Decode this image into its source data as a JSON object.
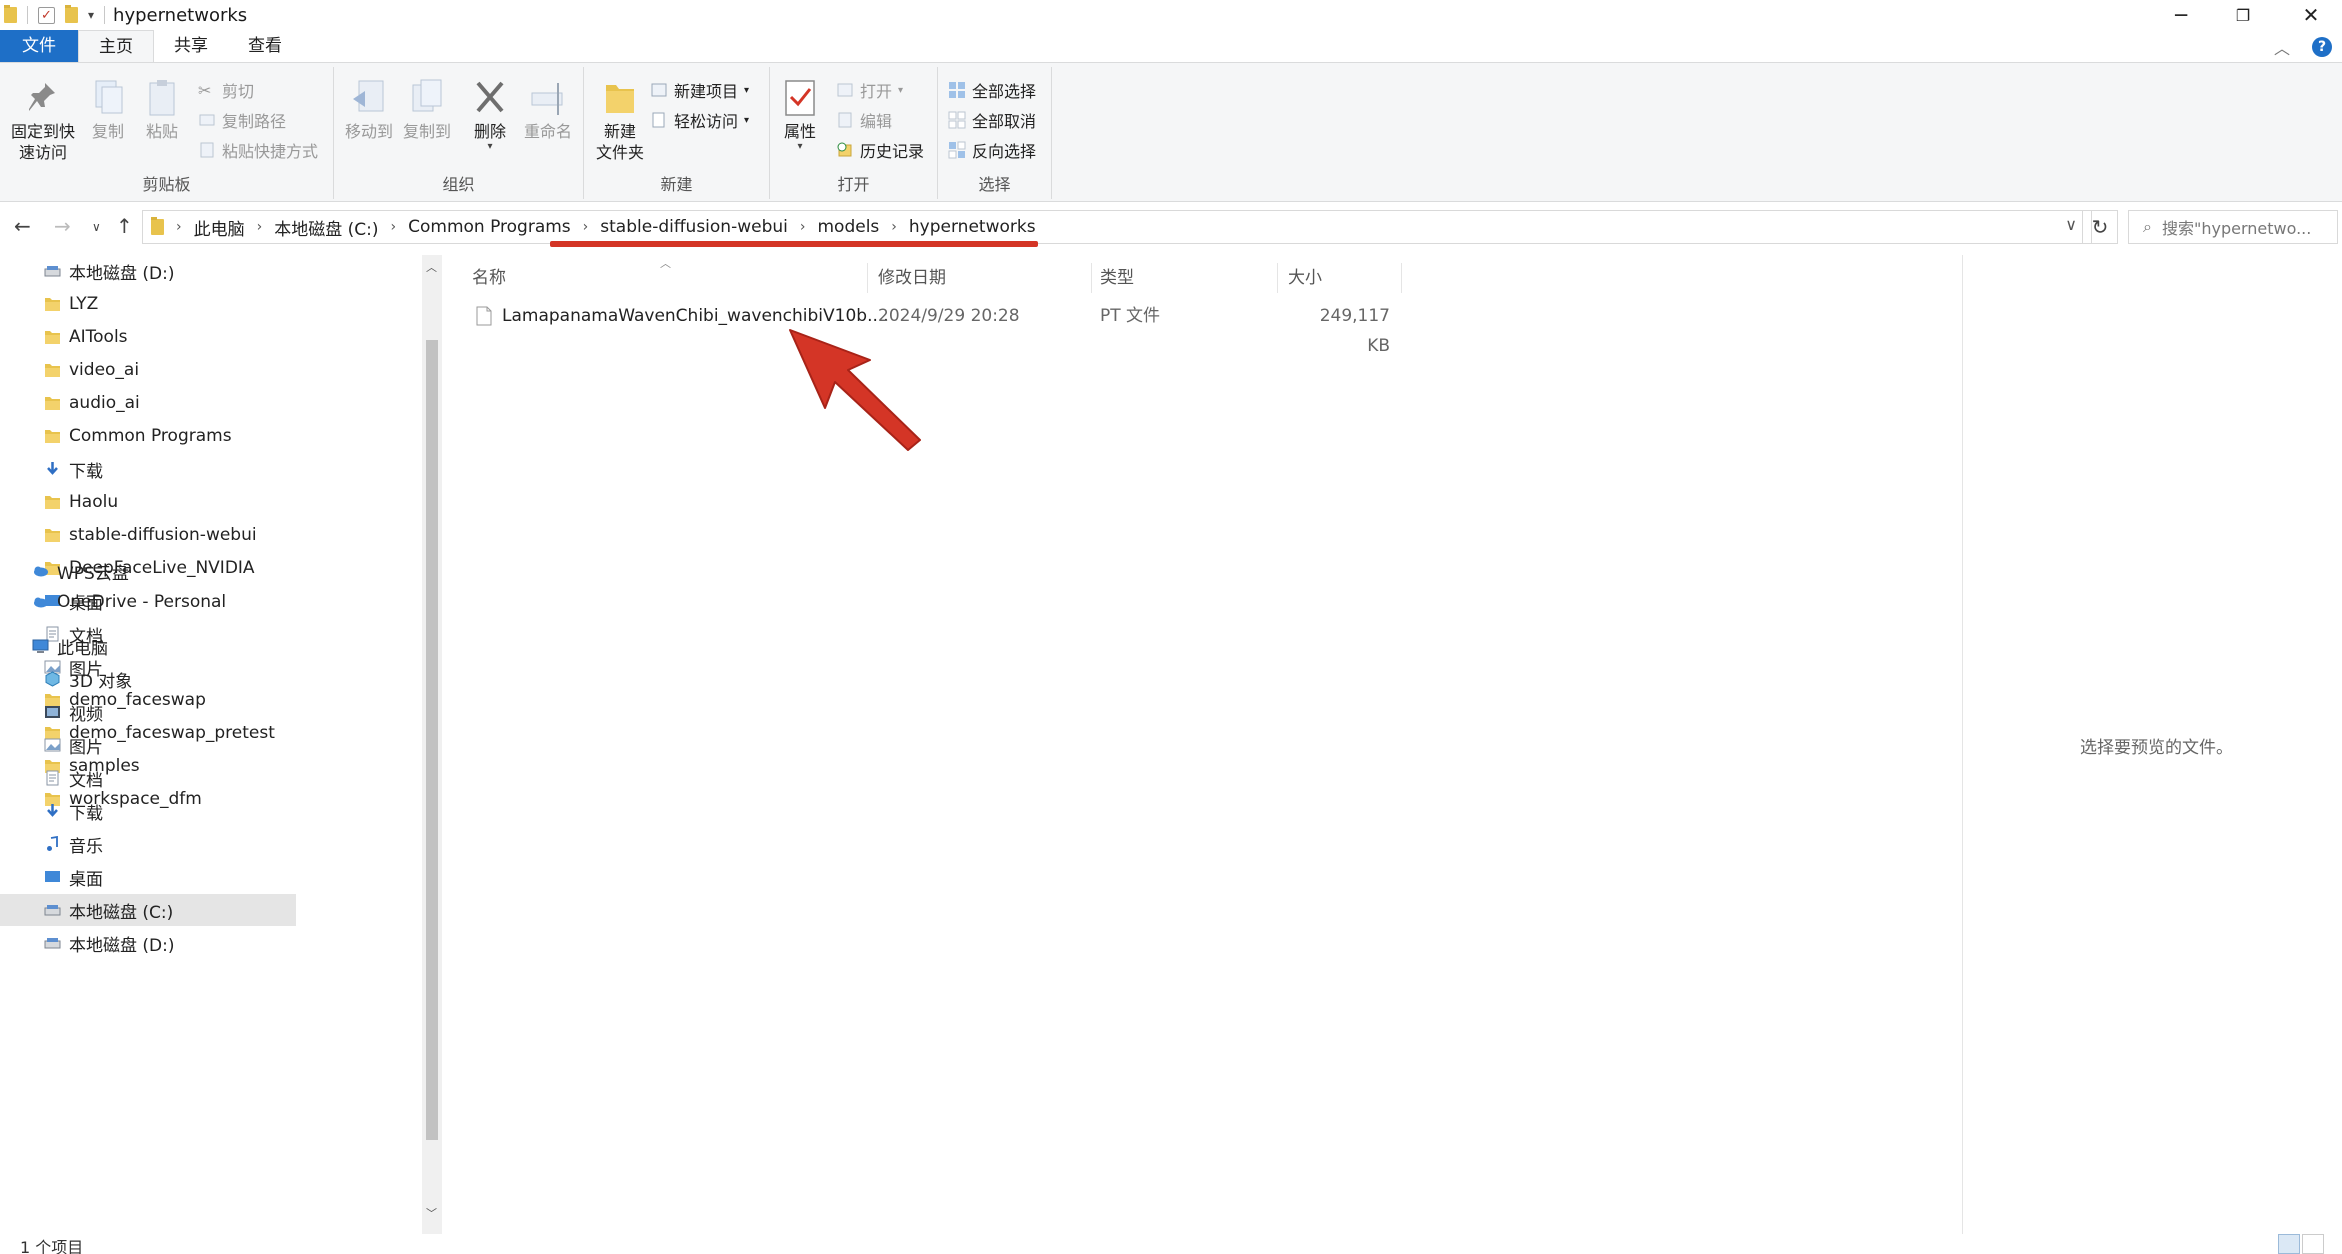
{
  "window": {
    "title": "hypernetworks"
  },
  "tabs": [
    {
      "label": "文件"
    },
    {
      "label": "主页"
    },
    {
      "label": "共享"
    },
    {
      "label": "查看"
    }
  ],
  "ribbon": {
    "clipboard": {
      "label": "剪贴板",
      "pin": "固定到快\n速访问",
      "pin_line1": "固定到快",
      "pin_line2": "速访问",
      "copy": "复制",
      "paste": "粘贴",
      "cut": "剪切",
      "copy_path": "复制路径",
      "paste_shortcut": "粘贴快捷方式"
    },
    "organize": {
      "label": "组织",
      "move_to": "移动到",
      "copy_to": "复制到",
      "delete": "删除",
      "rename": "重命名"
    },
    "new": {
      "label": "新建",
      "new_folder_line1": "新建",
      "new_folder_line2": "文件夹",
      "new_item": "新建项目",
      "easy_access": "轻松访问"
    },
    "open": {
      "label": "打开",
      "properties": "属性",
      "open": "打开",
      "edit": "编辑",
      "history": "历史记录"
    },
    "select": {
      "label": "选择",
      "select_all": "全部选择",
      "select_none": "全部取消",
      "invert": "反向选择"
    }
  },
  "address": {
    "crumbs": [
      "此电脑",
      "本地磁盘 (C:)",
      "Common Programs",
      "stable-diffusion-webui",
      "models",
      "hypernetworks"
    ]
  },
  "search": {
    "placeholder": "搜索\"hypernetwo..."
  },
  "sidebar": {
    "items": [
      {
        "label": "本地磁盘 (D:)",
        "icon": "drive-icon",
        "pinned": true
      },
      {
        "label": "LYZ",
        "icon": "folder-icon",
        "pinned": true
      },
      {
        "label": "AITools",
        "icon": "folder-icon",
        "pinned": true
      },
      {
        "label": "video_ai",
        "icon": "folder-icon",
        "pinned": true
      },
      {
        "label": "audio_ai",
        "icon": "folder-icon",
        "pinned": true
      },
      {
        "label": "Common Programs",
        "icon": "folder-icon",
        "pinned": true
      },
      {
        "label": "下载",
        "icon": "download-icon",
        "pinned": true
      },
      {
        "label": "Haolu",
        "icon": "folder-icon",
        "pinned": true
      },
      {
        "label": "stable-diffusion-webui",
        "icon": "folder-icon",
        "pinned": true
      },
      {
        "label": "DeepFaceLive_NVIDIA",
        "icon": "folder-icon",
        "pinned": true
      },
      {
        "label": "桌面",
        "icon": "desktop-icon",
        "pinned": true
      },
      {
        "label": "文档",
        "icon": "document-icon",
        "pinned": true
      },
      {
        "label": "图片",
        "icon": "pictures-icon",
        "pinned": true
      },
      {
        "label": "demo_faceswap",
        "icon": "folder-icon",
        "pinned": false
      },
      {
        "label": "demo_faceswap_pretest",
        "icon": "folder-icon",
        "pinned": false
      },
      {
        "label": "samples",
        "icon": "folder-icon",
        "pinned": false
      },
      {
        "label": "workspace_dfm",
        "icon": "folder-icon",
        "pinned": false
      }
    ],
    "wps": "WPS云盘",
    "onedrive": "OneDrive - Personal",
    "this_pc": "此电脑",
    "pc_items": [
      {
        "label": "3D 对象",
        "icon": "3d-objects-icon"
      },
      {
        "label": "视频",
        "icon": "videos-icon"
      },
      {
        "label": "图片",
        "icon": "pictures-icon"
      },
      {
        "label": "文档",
        "icon": "document-icon"
      },
      {
        "label": "下载",
        "icon": "download-icon"
      },
      {
        "label": "音乐",
        "icon": "music-icon"
      },
      {
        "label": "桌面",
        "icon": "desktop-icon"
      },
      {
        "label": "本地磁盘 (C:)",
        "icon": "drive-icon",
        "selected": true
      },
      {
        "label": "本地磁盘 (D:)",
        "icon": "drive-icon"
      }
    ]
  },
  "columns": {
    "name": "名称",
    "date": "修改日期",
    "type": "类型",
    "size": "大小"
  },
  "files": [
    {
      "name": "LamapanamaWavenChibi_wavenchibiV10b....",
      "date": "2024/9/29 20:28",
      "type": "PT 文件",
      "size": "249,117 KB"
    }
  ],
  "preview": {
    "empty_text": "选择要预览的文件。"
  },
  "status": {
    "count": "1 个项目"
  },
  "colors": {
    "accent": "#1e6fc7",
    "annotation": "#d43526",
    "folder": "#e8c34d"
  }
}
